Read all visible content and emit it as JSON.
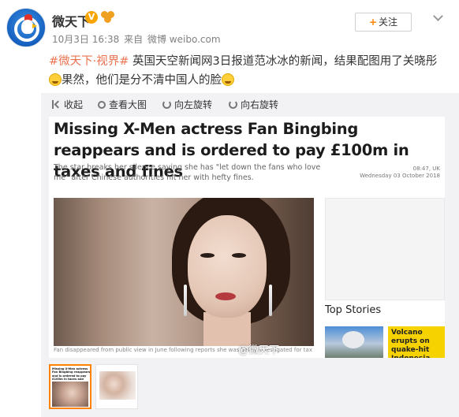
{
  "header": {
    "username": "微天下",
    "verified_badge": "V",
    "timestamp": "10月3日 16:38",
    "via_prefix": "来自",
    "via_source": "微博 weibo.com",
    "follow_label": "关注",
    "follow_icon": "+"
  },
  "post": {
    "hashtag": "#微天下·视界#",
    "text_part1": " 英国天空新闻网3日报道范冰冰的新闻，结果配图用了关晓彤",
    "text_part2": "果然，他们是分不清中国人的脸"
  },
  "toolbar": {
    "collapse": "收起",
    "view_large": "查看大图",
    "rotate_left": "向左旋转",
    "rotate_right": "向右旋转"
  },
  "article": {
    "title": "Missing X-Men actress Fan Bingbing reappears and is ordered to pay £100m in taxes and fines",
    "subtitle": "The star breaks her silence saying she has \"let down the fans who love me\" after Chinese authorities hit her with hefty fines.",
    "time_line1": "08:47, UK",
    "time_line2": "Wednesday 03 October 2018",
    "caption": "Fan disappeared from public view in June following reports she was being investigated for tax fraud",
    "top_stories": "Top Stories",
    "story_title": "Volcano erupts on quake-hit Indonesia"
  },
  "watermark": "@微天下",
  "thumbnails": [
    {
      "text": "Missing X-Men actress Fan Bingbing reappears and is ordered to pay £100m in taxes and fines"
    }
  ],
  "colors": {
    "accent": "#ff8200",
    "hashtag": "#eb7350",
    "panel_bg": "#f2f2f5",
    "story_tile": "#f6d200"
  },
  "icons": {
    "collapse": "collapse-icon",
    "view_large": "zoom-icon",
    "rotate_left": "rotate-left-icon",
    "rotate_right": "rotate-right-icon",
    "more": "chevron-down-icon"
  }
}
